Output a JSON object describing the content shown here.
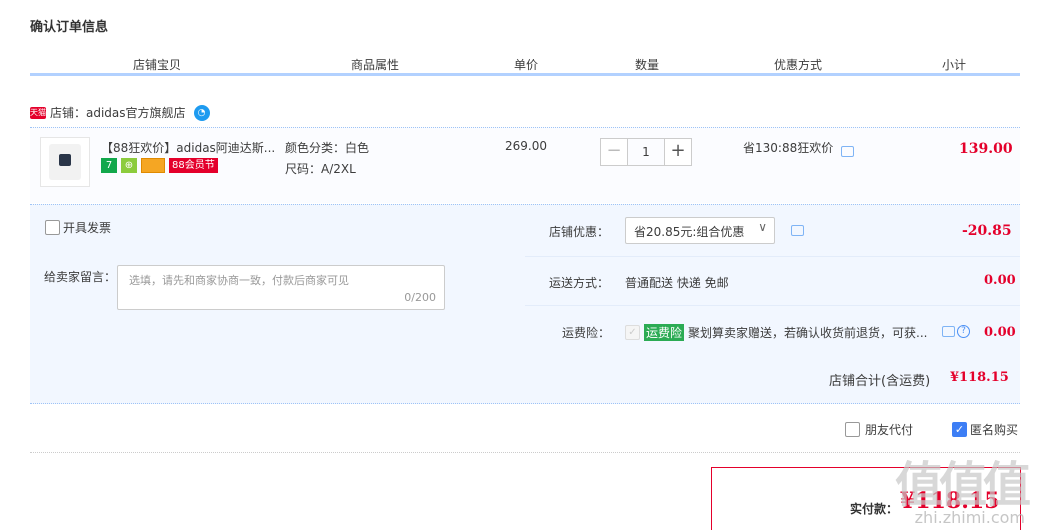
{
  "page": {
    "title": "确认订单信息"
  },
  "table_header": [
    "店铺宝贝",
    "商品属性",
    "单价",
    "数量",
    "优惠方式",
    "小计"
  ],
  "shop": {
    "tag": "天猫",
    "label": "店铺：adidas官方旗舰店",
    "ww_icon": "wangwang-icon"
  },
  "item": {
    "name": "【88狂欢价】adidas阿迪达斯...",
    "badge_seven": "7",
    "badge_88": "88会员节",
    "attr_color": "颜色分类：白色",
    "attr_size": "尺码：A/2XL",
    "price": "269.00",
    "qty_minus": "−",
    "qty_value": "1",
    "qty_plus": "+",
    "discount": "省130:88狂欢价",
    "subtotal": "139.00"
  },
  "invoice": {
    "label": "开具发票"
  },
  "message": {
    "label": "给卖家留言：",
    "placeholder": "选填，请先和商家协商一致，付款后商家可见",
    "counter": "0/200"
  },
  "shop_discount": {
    "label": "店铺优惠：",
    "selected": "省20.85元:组合优惠",
    "amount": "-20.85"
  },
  "delivery": {
    "label": "运送方式：",
    "value": "普通配送 快递 免邮",
    "amount": "0.00"
  },
  "insurance": {
    "label": "运费险：",
    "badge": "运费险",
    "text": "聚划算卖家赠送，若确认收货前退货，可获...",
    "amount": "0.00",
    "help": "?"
  },
  "shop_total": {
    "label": "店铺合计(含运费)",
    "amount": "¥118.15"
  },
  "options": {
    "friend_pay": "朋友代付",
    "anonymous": "匿名购买"
  },
  "payment": {
    "label": "实付款：",
    "amount": "¥118.15"
  },
  "watermark": {
    "glyphs": "值值值",
    "site": "zhi.zhimi.com"
  },
  "colors": {
    "accent_red": "#e4002b",
    "header_blue": "#b2d1ff",
    "panel_bg": "#f2f7ff",
    "checkbox_blue": "#3d7ef5",
    "green_badge": "#2bab54"
  }
}
